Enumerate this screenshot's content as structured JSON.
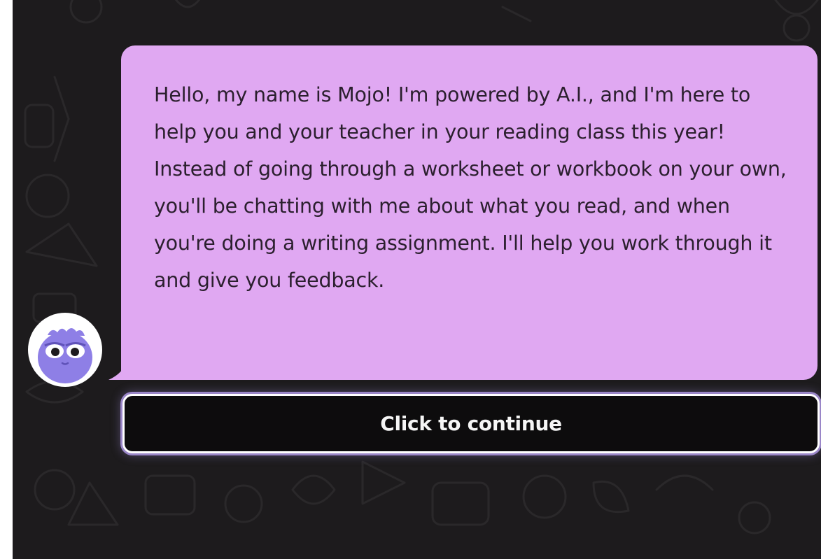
{
  "chat": {
    "assistant_name": "Mojo",
    "message": "Hello, my name is Mojo! I'm powered by A.I., and I'm here to help you and your teacher in your reading class this year! Instead of going through a worksheet or workbook on your own, you'll be chatting with me about what you read, and when you're doing a writing assignment. I'll help you work through it and give you feedback.",
    "avatar_icon": "mojo-avatar-icon"
  },
  "actions": {
    "continue_label": "Click to continue"
  },
  "colors": {
    "background": "#1d1b1d",
    "bubble": "#e0a8f2",
    "avatar_body": "#8e7fe6",
    "button_background": "#0d0c0d",
    "button_border": "#ffffff",
    "button_glow": "#9a86c8"
  }
}
